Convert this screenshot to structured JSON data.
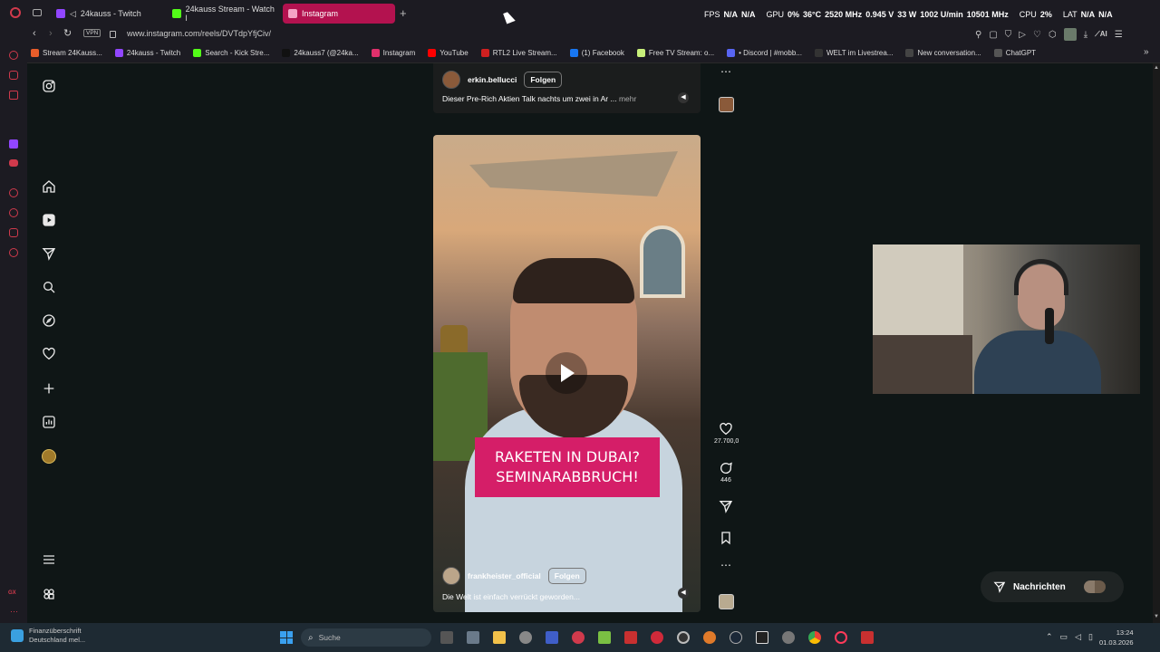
{
  "tabs": [
    {
      "label": "24kauss - Twitch",
      "color": "#9146ff"
    },
    {
      "label": "24kauss Stream - Watch l",
      "color": "#53fc18"
    },
    {
      "label": "Instagram",
      "color": "#e1306c"
    }
  ],
  "overlay": {
    "fps_label": "FPS",
    "fps_val1": "N/A",
    "fps_val2": "N/A",
    "gpu_label": "GPU",
    "gpu_load": "0%",
    "gpu_temp": "36°C",
    "gpu_clock": "2520 MHz",
    "gpu_volt": "0.945 V",
    "gpu_power": "33 W",
    "gpu_fan": "1002 U/min",
    "gpu_mem": "10501 MHz",
    "cpu_label": "CPU",
    "cpu_load": "2%",
    "lat_label": "LAT",
    "lat_val1": "N/A",
    "lat_val2": "N/A"
  },
  "address": {
    "vpn": "VPN",
    "url": "www.instagram.com/reels/DVTdpYfjCiv/",
    "ai": "AI"
  },
  "bookmarks": [
    {
      "label": "Stream 24Kauss...",
      "color": "#e85d2a"
    },
    {
      "label": "24kauss - Twitch",
      "color": "#9146ff"
    },
    {
      "label": "Search - Kick Stre...",
      "color": "#53fc18"
    },
    {
      "label": "24kauss7 (@24ka...",
      "color": "#111111"
    },
    {
      "label": "Instagram",
      "color": "#e1306c"
    },
    {
      "label": "YouTube",
      "color": "#ff0000"
    },
    {
      "label": "RTL2 Live Stream...",
      "color": "#d02020"
    },
    {
      "label": "(1) Facebook",
      "color": "#1877f2"
    },
    {
      "label": "Free TV Stream: o...",
      "color": "#c8f07a"
    },
    {
      "label": "• Discord | #mobb...",
      "color": "#5865f2"
    },
    {
      "label": "WELT im Livestrea...",
      "color": "#333333"
    },
    {
      "label": "New conversation...",
      "color": "#444444"
    },
    {
      "label": "ChatGPT",
      "color": "#555555"
    }
  ],
  "reel_top": {
    "username": "erkin.bellucci",
    "follow": "Folgen",
    "caption": "Dieser Pre-Rich Aktien Talk nachts um zwei in Ar ...",
    "more": "mehr",
    "more_icon": "⋯"
  },
  "reel_main": {
    "overlay_line1": "RAKETEN IN DUBAI?",
    "overlay_line2": "SEMINARABBRUCH!",
    "username": "frankheister_official",
    "follow": "Folgen",
    "caption": "Die Welt ist einfach verrückt geworden...",
    "likes": "27.700,0",
    "comments": "446",
    "more_icon": "⋯"
  },
  "messages": {
    "label": "Nachrichten"
  },
  "taskbar": {
    "weather_line1": "Finanzüberschrift",
    "weather_line2": "Deutschland mel...",
    "search": "Suche",
    "time": "13:24",
    "date": "01.03.2026"
  },
  "colors": {
    "accent": "#d51e68",
    "opera": "#d03a4c",
    "page_bg": "#0f1616"
  }
}
